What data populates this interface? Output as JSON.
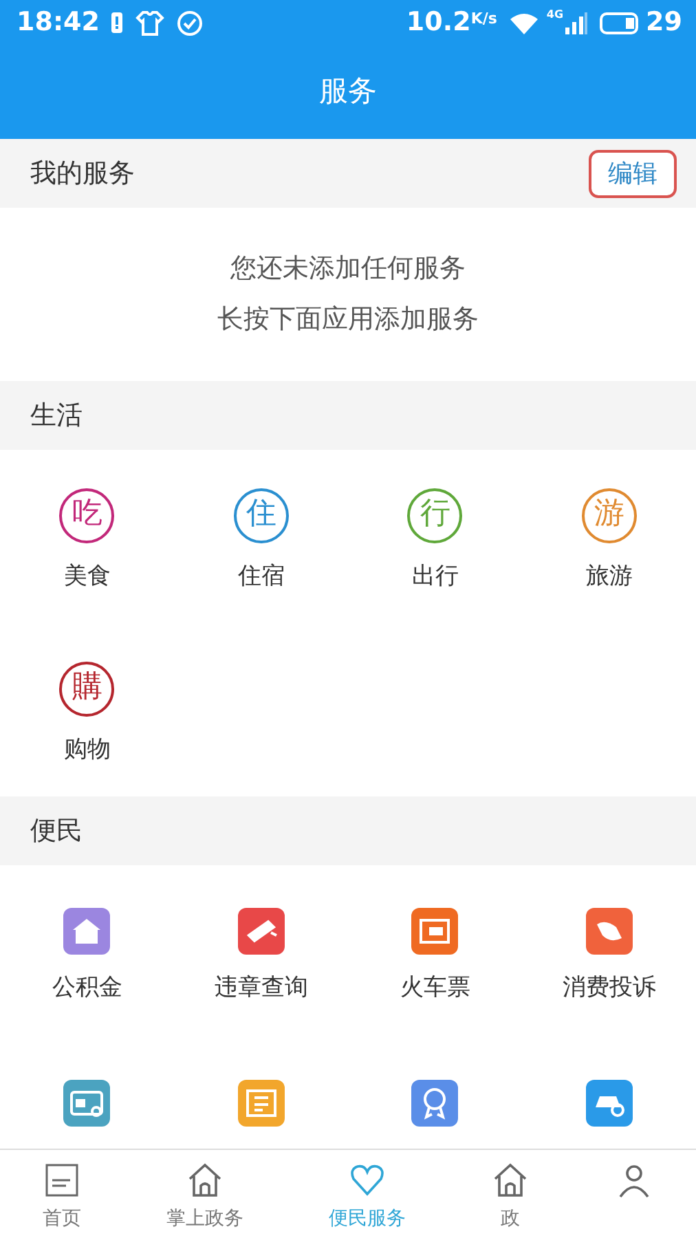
{
  "status_bar": {
    "time": "18:42",
    "speed": "10.2",
    "speed_unit": "K/s",
    "network": "4G",
    "battery": "29"
  },
  "header": {
    "title": "服务"
  },
  "my_services": {
    "title": "我的服务",
    "edit_button": "编辑",
    "empty_lines": [
      "您还未添加任何服务",
      "长按下面应用添加服务"
    ]
  },
  "sections": [
    {
      "title": "生活",
      "items": [
        {
          "kind": "stamp",
          "glyph": "吃",
          "label": "美食",
          "color": "#c2287a"
        },
        {
          "kind": "stamp",
          "glyph": "住",
          "label": "住宿",
          "color": "#2a8fd0"
        },
        {
          "kind": "stamp",
          "glyph": "行",
          "label": "出行",
          "color": "#5fa83a"
        },
        {
          "kind": "stamp",
          "glyph": "游",
          "label": "旅游",
          "color": "#e08a30"
        },
        {
          "kind": "stamp",
          "glyph": "購",
          "label": "购物",
          "color": "#b5262e"
        }
      ]
    },
    {
      "title": "便民",
      "items": [
        {
          "kind": "tile",
          "label": "公积金",
          "color": "#9b86e0"
        },
        {
          "kind": "tile",
          "label": "违章查询",
          "color": "#e84848"
        },
        {
          "kind": "tile",
          "label": "火车票",
          "color": "#ef6a22"
        },
        {
          "kind": "tile",
          "label": "消费投诉",
          "color": "#f0623c"
        },
        {
          "kind": "tile",
          "color": "#4ba3c0"
        },
        {
          "kind": "tile",
          "color": "#f2a62c"
        },
        {
          "kind": "tile",
          "color": "#5a8ee8"
        },
        {
          "kind": "tile",
          "color": "#2a9ae8"
        }
      ]
    }
  ],
  "bottom_nav": [
    {
      "label": "首页",
      "selected": false
    },
    {
      "label": "掌上政务",
      "selected": false
    },
    {
      "label": "便民服务",
      "selected": true
    },
    {
      "label": "政",
      "selected": false
    },
    {
      "selected": false
    }
  ]
}
